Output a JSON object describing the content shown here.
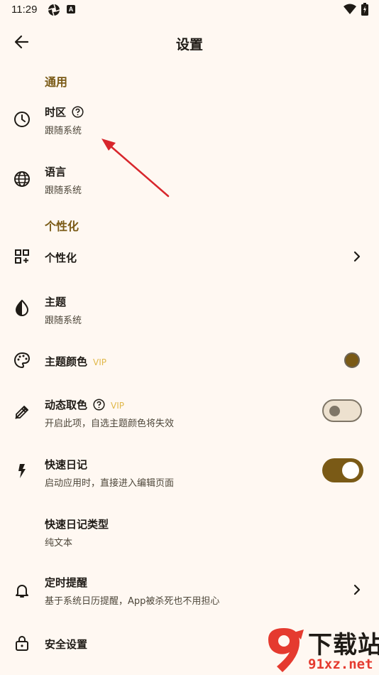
{
  "status_bar": {
    "time": "11:29",
    "a_badge": "A"
  },
  "app_bar": {
    "title": "设置"
  },
  "sections": {
    "general": "通用",
    "personalize": "个性化"
  },
  "rows": {
    "timezone": {
      "title": "时区",
      "sub": "跟随系统"
    },
    "language": {
      "title": "语言",
      "sub": "跟随系统"
    },
    "personalize": {
      "title": "个性化"
    },
    "theme": {
      "title": "主题",
      "sub": "跟随系统"
    },
    "theme_color": {
      "title": "主题颜色",
      "badge": "VIP",
      "color": "#7a5a16"
    },
    "dynamic_color": {
      "title": "动态取色",
      "badge": "VIP",
      "sub": "开启此项，自选主题颜色将失效",
      "enabled": false
    },
    "quick_diary": {
      "title": "快速日记",
      "sub": "启动应用时，直接进入编辑页面",
      "enabled": true
    },
    "quick_diary_type": {
      "title": "快速日记类型",
      "sub": "纯文本"
    },
    "reminder": {
      "title": "定时提醒",
      "sub": "基于系统日历提醒，App被杀死也不用担心"
    },
    "security": {
      "title": "安全设置"
    }
  },
  "watermark": {
    "text": "下载站",
    "url": "91xz.net"
  },
  "colors": {
    "accent": "#7a5a16",
    "background": "#fff8f2",
    "vip": "#e0b84a",
    "arrow": "#d8262c"
  }
}
